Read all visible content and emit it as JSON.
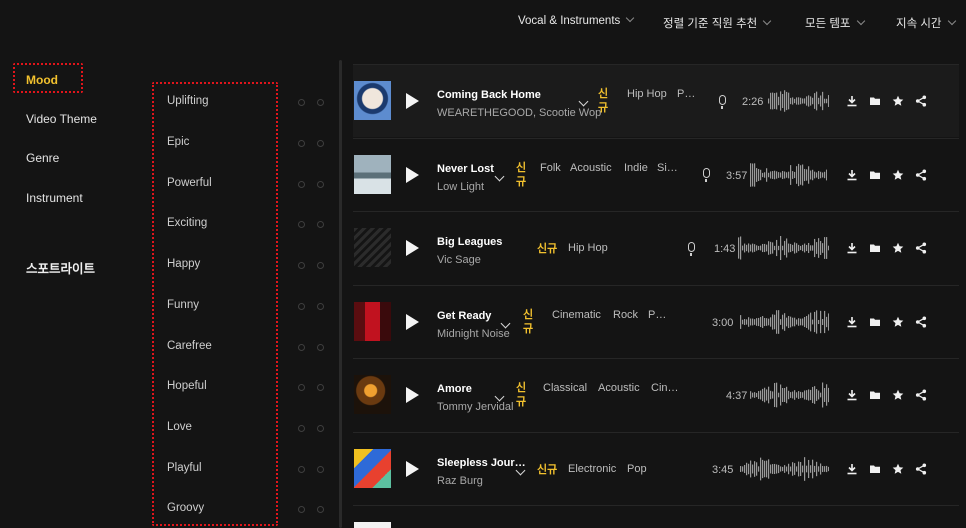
{
  "filters": [
    {
      "label": "Vocal & Instruments"
    },
    {
      "label": "정렬 기준 직원 추천"
    },
    {
      "label": "모든 템포"
    },
    {
      "label": "지속 시간"
    }
  ],
  "categories": [
    "Mood",
    "Video Theme",
    "Genre",
    "Instrument"
  ],
  "spotlight_label": "스포트라이트",
  "moods": [
    "Uplifting",
    "Epic",
    "Powerful",
    "Exciting",
    "Happy",
    "Funny",
    "Carefree",
    "Hopeful",
    "Love",
    "Playful",
    "Groovy"
  ],
  "colors": {
    "accent": "#f2c12e",
    "highlight_border": "#e0151b",
    "background": "#141414"
  },
  "icons": {
    "play": "play-icon",
    "mic": "microphone-icon",
    "download": "download-icon",
    "folder": "folder-icon",
    "star": "star-icon",
    "share": "share-icon"
  },
  "tracks": [
    {
      "title": "Coming Back Home",
      "artist": "WEARETHEGOOD, Scootie Wop",
      "new": "신\n규",
      "tags": [
        "Hip Hop",
        "P…"
      ],
      "vocal": true,
      "duration": "2:26"
    },
    {
      "title": "Never Lost",
      "artist": "Low Light",
      "new": "신\n규",
      "tags": [
        "Folk",
        "Acoustic",
        "Indie",
        "Si…"
      ],
      "vocal": true,
      "duration": "3:57"
    },
    {
      "title": "Big Leagues",
      "artist": "Vic Sage",
      "new": "신규",
      "tags": [
        "Hip Hop"
      ],
      "vocal": true,
      "duration": "1:43"
    },
    {
      "title": "Get Ready",
      "artist": "Midnight Noise",
      "new": "신\n규",
      "tags": [
        "Cinematic",
        "Rock",
        "P…"
      ],
      "vocal": false,
      "duration": "3:00"
    },
    {
      "title": "Amore",
      "artist": "Tommy Jervidal",
      "new": "신\n규",
      "tags": [
        "Classical",
        "Acoustic",
        "Cin…"
      ],
      "vocal": false,
      "duration": "4:37"
    },
    {
      "title": "Sleepless Jour…",
      "artist": "Raz Burg",
      "new": "신규",
      "tags": [
        "Electronic",
        "Pop"
      ],
      "vocal": false,
      "duration": "3:45"
    }
  ]
}
